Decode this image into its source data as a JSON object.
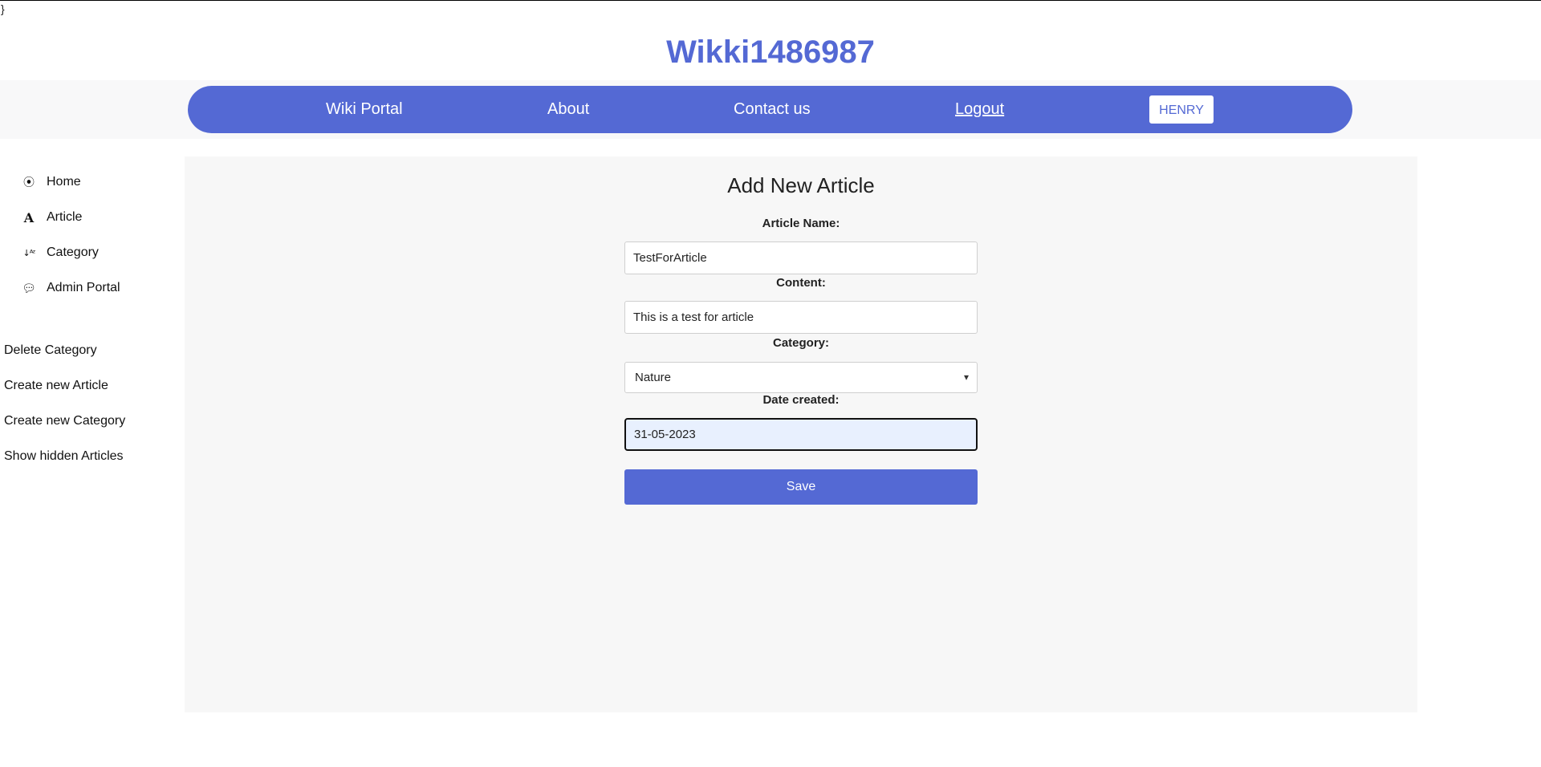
{
  "stray_char": "}",
  "site_title": "Wikki1486987",
  "navbar": {
    "links": [
      "Wiki Portal",
      "About",
      "Contact us",
      "Logout"
    ],
    "user_button": "HENRY"
  },
  "sidebar": {
    "items": [
      {
        "label": "Home",
        "icon": "play-circle-icon"
      },
      {
        "label": "Article",
        "icon": "font-letter-icon"
      },
      {
        "label": "Category",
        "icon": "sort-alpha-icon"
      },
      {
        "label": "Admin Portal",
        "icon": "chat-bubble-icon"
      }
    ],
    "admin_links": [
      "Delete Category",
      "Create new Article",
      "Create new Category",
      "Show hidden Articles"
    ]
  },
  "form": {
    "title": "Add New Article",
    "article_name_label": "Article Name:",
    "article_name_value": "TestForArticle",
    "content_label": "Content:",
    "content_value": "This is a test for article",
    "category_label": "Category:",
    "category_value": "Nature",
    "date_label": "Date created:",
    "date_value": "31-05-2023",
    "save_label": "Save"
  },
  "colors": {
    "accent": "#5469d4",
    "panel_bg": "#f7f7f7",
    "focused_field_bg": "#e8f0fe"
  }
}
